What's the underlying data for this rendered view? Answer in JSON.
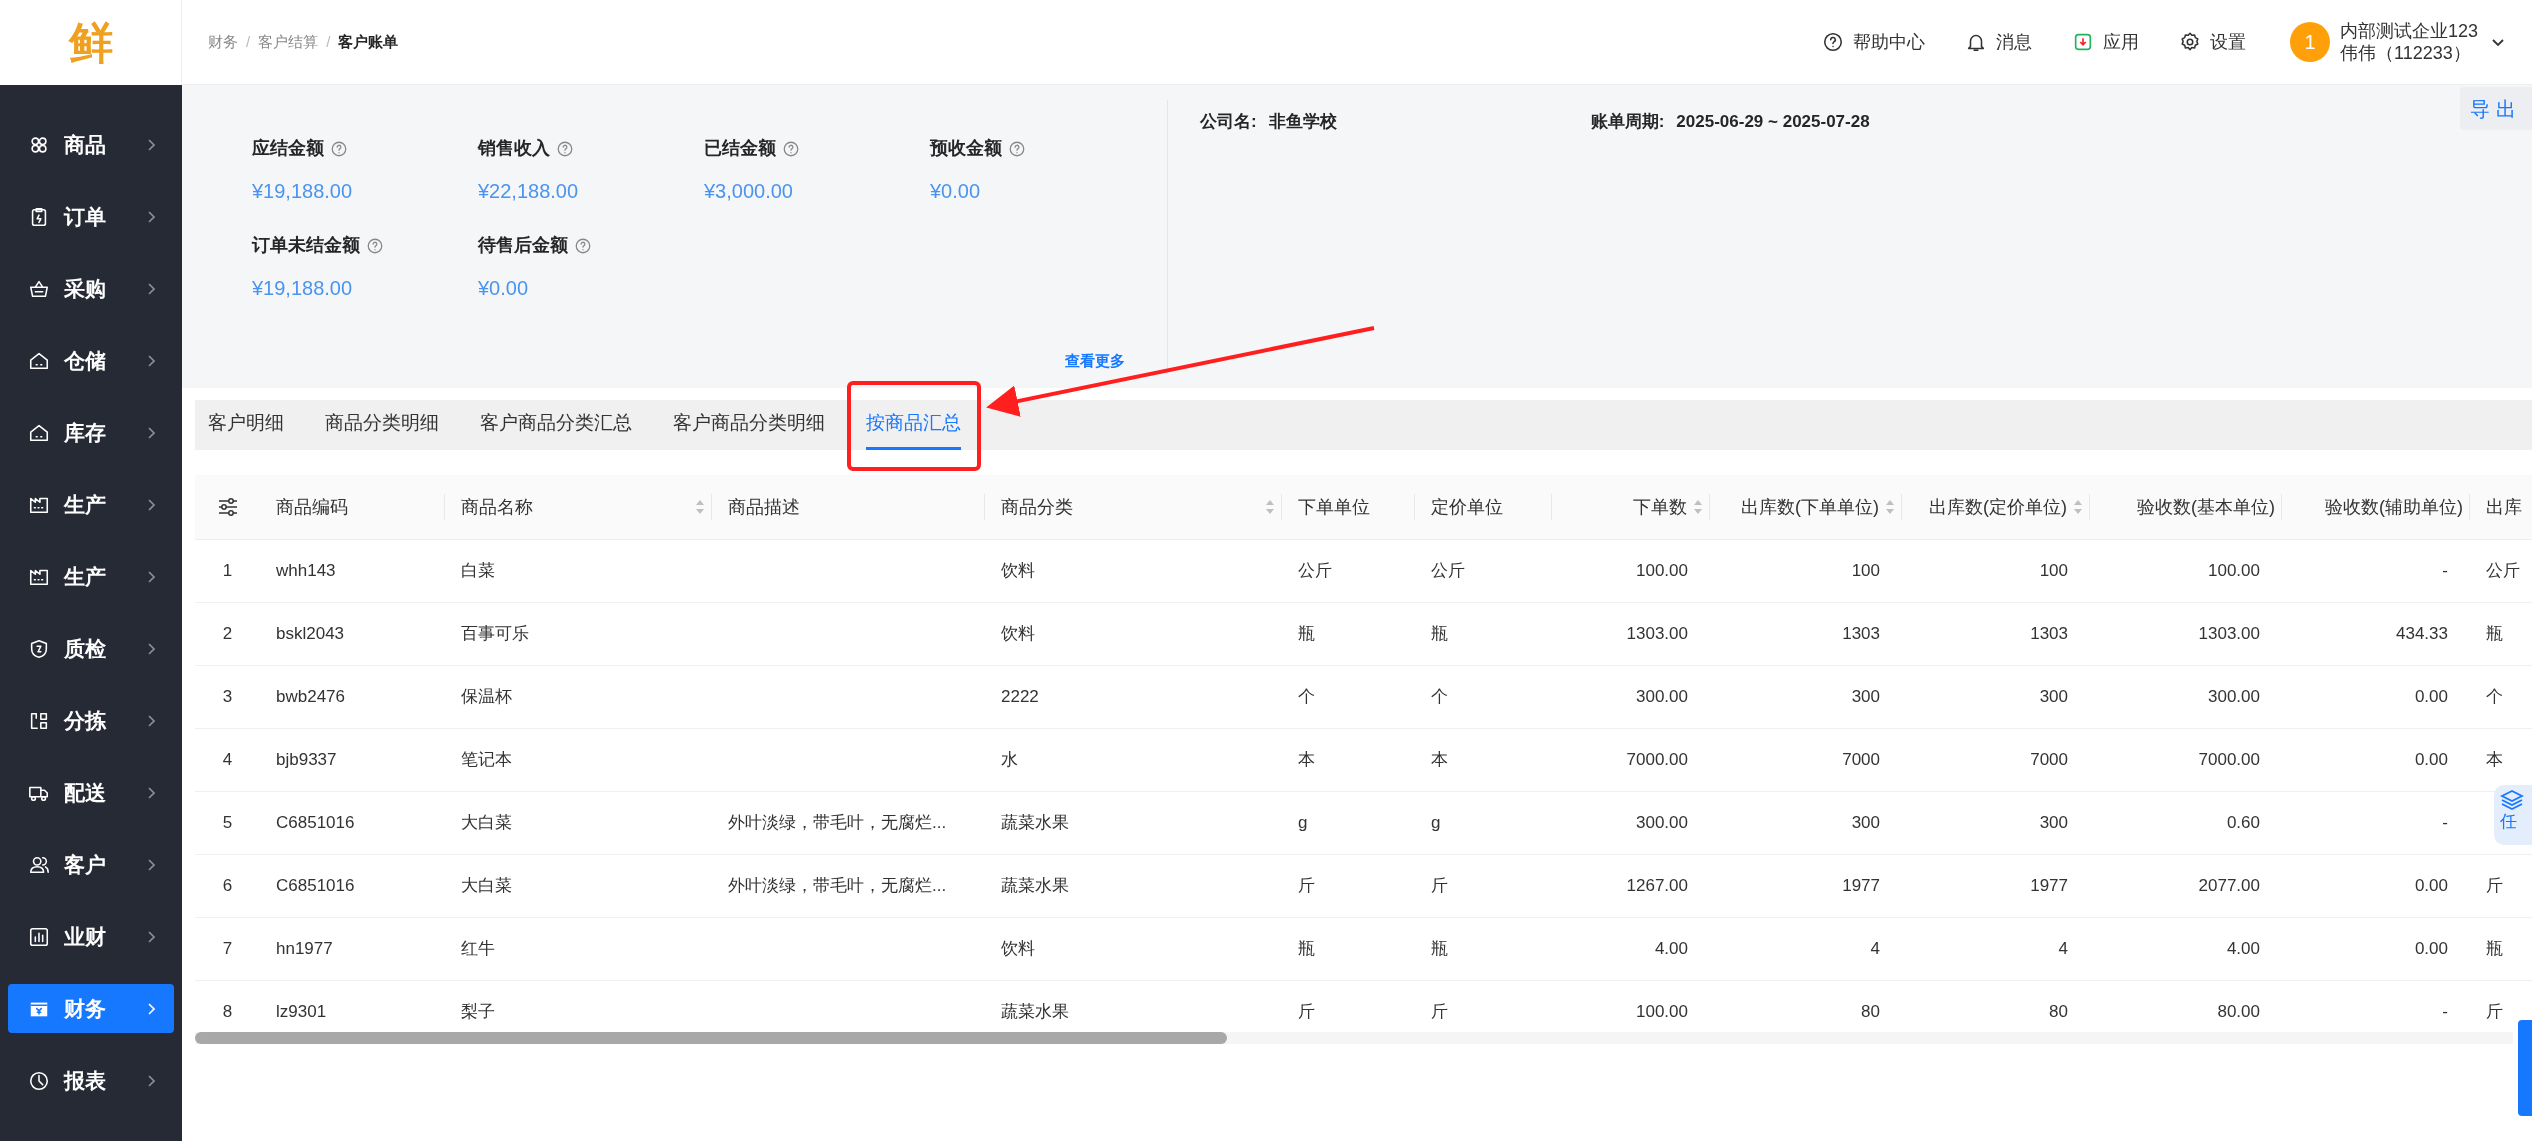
{
  "header": {
    "logo": "鲜",
    "breadcrumb": [
      {
        "kind": "link",
        "label": "财务"
      },
      {
        "kind": "separator",
        "label": "/"
      },
      {
        "kind": "link",
        "label": "客户结算"
      },
      {
        "kind": "separator",
        "label": "/"
      },
      {
        "kind": "current",
        "label": "客户账单"
      }
    ],
    "actions": [
      {
        "kind": "help",
        "label": "帮助中心"
      },
      {
        "kind": "bell",
        "label": "消息"
      },
      {
        "kind": "app",
        "label": "应用"
      },
      {
        "kind": "gear",
        "label": "设置"
      }
    ],
    "user": {
      "badge": "1",
      "company": "内部测试企业123",
      "name": "伟伟（112233）"
    }
  },
  "sidebar": {
    "items": [
      {
        "kind": "clover",
        "label": "商品",
        "selected": false
      },
      {
        "kind": "clipboard",
        "label": "订单",
        "selected": false
      },
      {
        "kind": "basket",
        "label": "采购",
        "selected": false
      },
      {
        "kind": "house",
        "label": "仓储",
        "selected": false
      },
      {
        "kind": "house",
        "label": "库存",
        "selected": false
      },
      {
        "kind": "factory",
        "label": "生产",
        "selected": false
      },
      {
        "kind": "factory",
        "label": "生产",
        "selected": false
      },
      {
        "kind": "shield",
        "label": "质检",
        "selected": false
      },
      {
        "kind": "split",
        "label": "分拣",
        "selected": false
      },
      {
        "kind": "truck",
        "label": "配送",
        "selected": false
      },
      {
        "kind": "user",
        "label": "客户",
        "selected": false
      },
      {
        "kind": "chart",
        "label": "业财",
        "selected": false
      },
      {
        "kind": "wallet",
        "label": "财务",
        "selected": true
      },
      {
        "kind": "pie",
        "label": "报表",
        "selected": false
      }
    ]
  },
  "summary": {
    "metrics": [
      {
        "label": "应结金额",
        "value": "¥19,188.00"
      },
      {
        "label": "销售收入",
        "value": "¥22,188.00"
      },
      {
        "label": "已结金额",
        "value": "¥3,000.00"
      },
      {
        "label": "预收金额",
        "value": "¥0.00"
      },
      {
        "label": "订单未结金额",
        "value": "¥19,188.00"
      },
      {
        "label": "待售后金额",
        "value": "¥0.00"
      }
    ],
    "more_link": "查看更多",
    "company_label": "公司名:",
    "company": "非鱼学校",
    "period_label": "账单周期:",
    "period": "2025-06-29 ~ 2025-07-28",
    "export_button": "导出"
  },
  "tabs": [
    {
      "label": "客户明细",
      "selected": false
    },
    {
      "label": "商品分类明细",
      "selected": false
    },
    {
      "label": "客户商品分类汇总",
      "selected": false
    },
    {
      "label": "客户商品分类明细",
      "selected": false
    },
    {
      "label": "按商品汇总",
      "selected": true
    }
  ],
  "table": {
    "columns": [
      {
        "label": "商品编码",
        "kind": "text",
        "sortable": false
      },
      {
        "label": "商品名称",
        "kind": "text",
        "sortable": true
      },
      {
        "label": "商品描述",
        "kind": "text",
        "sortable": false
      },
      {
        "label": "商品分类",
        "kind": "text",
        "sortable": true
      },
      {
        "label": "下单单位",
        "kind": "text",
        "sortable": false
      },
      {
        "label": "定价单位",
        "kind": "text",
        "sortable": false
      },
      {
        "label": "下单数",
        "kind": "number",
        "sortable": true
      },
      {
        "label": "出库数(下单单位)",
        "kind": "number",
        "sortable": true
      },
      {
        "label": "出库数(定价单位)",
        "kind": "number",
        "sortable": true
      },
      {
        "label": "验收数(基本单位)",
        "kind": "number",
        "sortable": false
      },
      {
        "label": "验收数(辅助单位)",
        "kind": "number",
        "sortable": false
      },
      {
        "label": "出库",
        "kind": "text",
        "sortable": false
      }
    ],
    "rows": [
      {
        "index": "1",
        "cells": [
          "whh143",
          "白菜",
          null,
          "饮料",
          "公斤",
          "公斤",
          "100.00",
          "100",
          "100",
          "100.00",
          "-",
          "公斤"
        ]
      },
      {
        "index": "2",
        "cells": [
          "bskl2043",
          "百事可乐",
          null,
          "饮料",
          "瓶",
          "瓶",
          "1303.00",
          "1303",
          "1303",
          "1303.00",
          "434.33",
          "瓶"
        ]
      },
      {
        "index": "3",
        "cells": [
          "bwb2476",
          "保温杯",
          null,
          "2222",
          "个",
          "个",
          "300.00",
          "300",
          "300",
          "300.00",
          "0.00",
          "个"
        ]
      },
      {
        "index": "4",
        "cells": [
          "bjb9337",
          "笔记本",
          null,
          "水",
          "本",
          "本",
          "7000.00",
          "7000",
          "7000",
          "7000.00",
          "0.00",
          "本"
        ]
      },
      {
        "index": "5",
        "cells": [
          "C6851016",
          "大白菜",
          "外叶淡绿，带毛叶，无腐烂...",
          "蔬菜水果",
          "g",
          "g",
          "300.00",
          "300",
          "300",
          "0.60",
          "-",
          null
        ]
      },
      {
        "index": "6",
        "cells": [
          "C6851016",
          "大白菜",
          "外叶淡绿，带毛叶，无腐烂...",
          "蔬菜水果",
          "斤",
          "斤",
          "1267.00",
          "1977",
          "1977",
          "2077.00",
          "0.00",
          "斤"
        ]
      },
      {
        "index": "7",
        "cells": [
          "hn1977",
          "红牛",
          null,
          "饮料",
          "瓶",
          "瓶",
          "4.00",
          "4",
          "4",
          "4.00",
          "0.00",
          "瓶"
        ]
      },
      {
        "index": "8",
        "cells": [
          "lz9301",
          "梨子",
          null,
          "蔬菜水果",
          "斤",
          "斤",
          "100.00",
          "80",
          "80",
          "80.00",
          "-",
          "斤"
        ]
      }
    ]
  },
  "float_widget": {
    "label": "任"
  }
}
